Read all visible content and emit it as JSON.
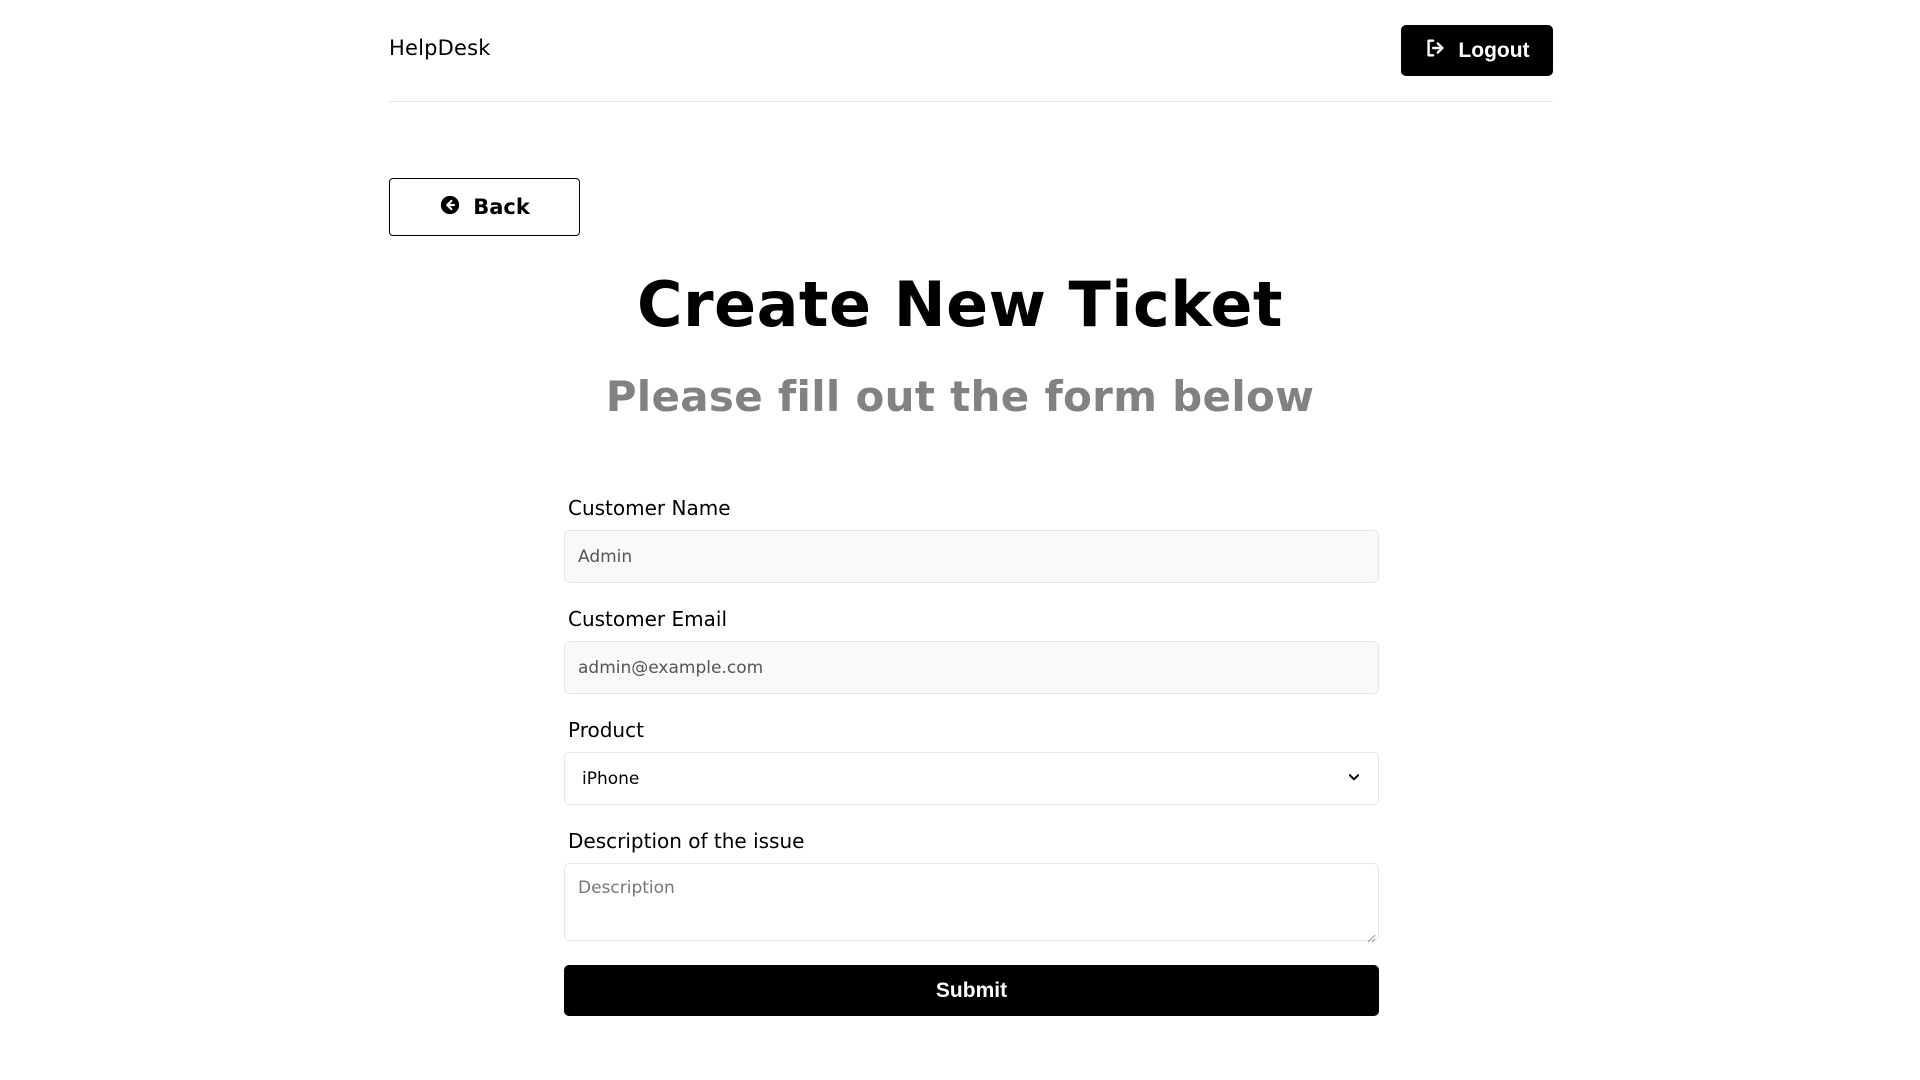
{
  "header": {
    "logo_text": "HelpDesk",
    "logout_label": "Logout",
    "logout_icon": "sign-out-icon"
  },
  "back_button": {
    "label": "Back",
    "icon": "arrow-circle-left-icon"
  },
  "page": {
    "title": "Create New Ticket",
    "subtitle": "Please fill out the form below"
  },
  "form": {
    "customer_name": {
      "label": "Customer Name",
      "value": "Admin"
    },
    "customer_email": {
      "label": "Customer Email",
      "value": "admin@example.com"
    },
    "product": {
      "label": "Product",
      "selected": "iPhone",
      "icon": "chevron-down-icon"
    },
    "description": {
      "label": "Description of the issue",
      "placeholder": "Description"
    },
    "submit_label": "Submit"
  },
  "colors": {
    "primary": "#000000",
    "subtitle": "#828282",
    "field_bg_disabled": "#f9f9f9",
    "border": "#e6e6e6"
  }
}
